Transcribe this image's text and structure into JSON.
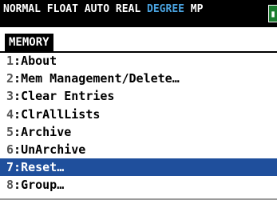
{
  "status_bar": {
    "mode_prefix": "NORMAL FLOAT AUTO REAL ",
    "angle_mode": "DEGREE",
    "mode_suffix": " MP",
    "battery_glyph": "▮",
    "colors": {
      "background": "#000000",
      "text": "#ffffff",
      "angle_mode": "#4aa3e0",
      "battery": "#1b7d2f"
    }
  },
  "menu": {
    "title": "MEMORY",
    "selected_index": 6,
    "highlight_color": "#1f4f9c",
    "items": [
      {
        "number": "1",
        "label": "About"
      },
      {
        "number": "2",
        "label": "Mem Management/Delete…"
      },
      {
        "number": "3",
        "label": "Clear Entries"
      },
      {
        "number": "4",
        "label": "ClrAllLists"
      },
      {
        "number": "5",
        "label": "Archive"
      },
      {
        "number": "6",
        "label": "UnArchive"
      },
      {
        "number": "7",
        "label": "Reset…"
      },
      {
        "number": "8",
        "label": "Group…"
      }
    ]
  }
}
